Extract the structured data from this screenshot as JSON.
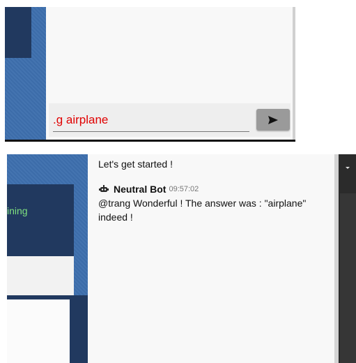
{
  "composer": {
    "input_value": ".g airplane",
    "send_icon": "send-arrow-icon"
  },
  "sidebar": {
    "card_status_fragment": "ining"
  },
  "chat": {
    "messages": [
      {
        "text": "Let's get started !"
      },
      {
        "author": "Neutral Bot",
        "time": "09:57:02",
        "avatar_icon": "robot-icon",
        "text": "@trang Wonderful ! The answer was : \"airplane\" indeed !"
      }
    ]
  },
  "colors": {
    "background_blue": "#3e6fae",
    "card_dark_blue": "#21395f",
    "chat_background": "#f8f8f8",
    "input_text_red": "#e00000",
    "status_green": "#7fe07f",
    "send_button_gray": "#9a9a9a"
  }
}
